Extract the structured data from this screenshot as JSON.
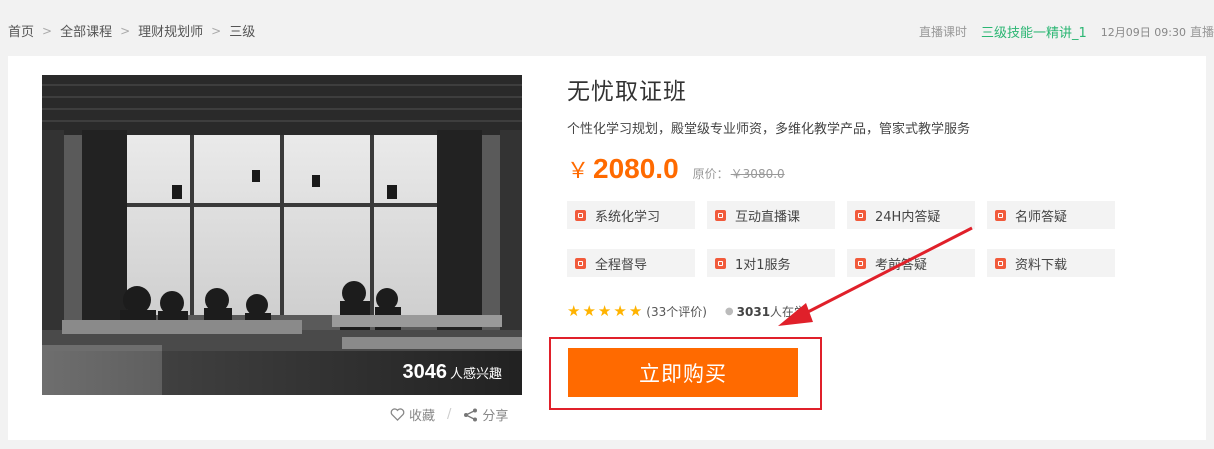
{
  "breadcrumb": {
    "items": [
      "首页",
      "全部课程",
      "理财规划师",
      "三级"
    ],
    "separator": ">"
  },
  "live": {
    "label": "直播课时",
    "course": "三级技能一精讲_1",
    "time": "12月09日 09:30",
    "tail": "直播"
  },
  "course": {
    "title": "无忧取证班",
    "subtitle": "个性化学习规划，殿堂级专业师资，多维化教学产品，管家式教学服务",
    "currency": "￥",
    "price": "2080.0",
    "original_label": "原价：",
    "original_price": "￥3080.0",
    "interest_count": "3046",
    "interest_text": "人感兴趣",
    "features": [
      "系统化学习",
      "互动直播课",
      "24H内答疑",
      "名师答疑",
      "全程督导",
      "1对1服务",
      "考前答疑",
      "资料下载"
    ],
    "rating_stars": 5,
    "reviews": "(33个评价)",
    "learners_count": "3031",
    "learners_text": "人在学"
  },
  "actions": {
    "favorite": "收藏",
    "share": "分享",
    "buy": "立即购买"
  },
  "colors": {
    "accent": "#ff6a00",
    "live_green": "#2bb673",
    "highlight_red": "#e0202a"
  }
}
